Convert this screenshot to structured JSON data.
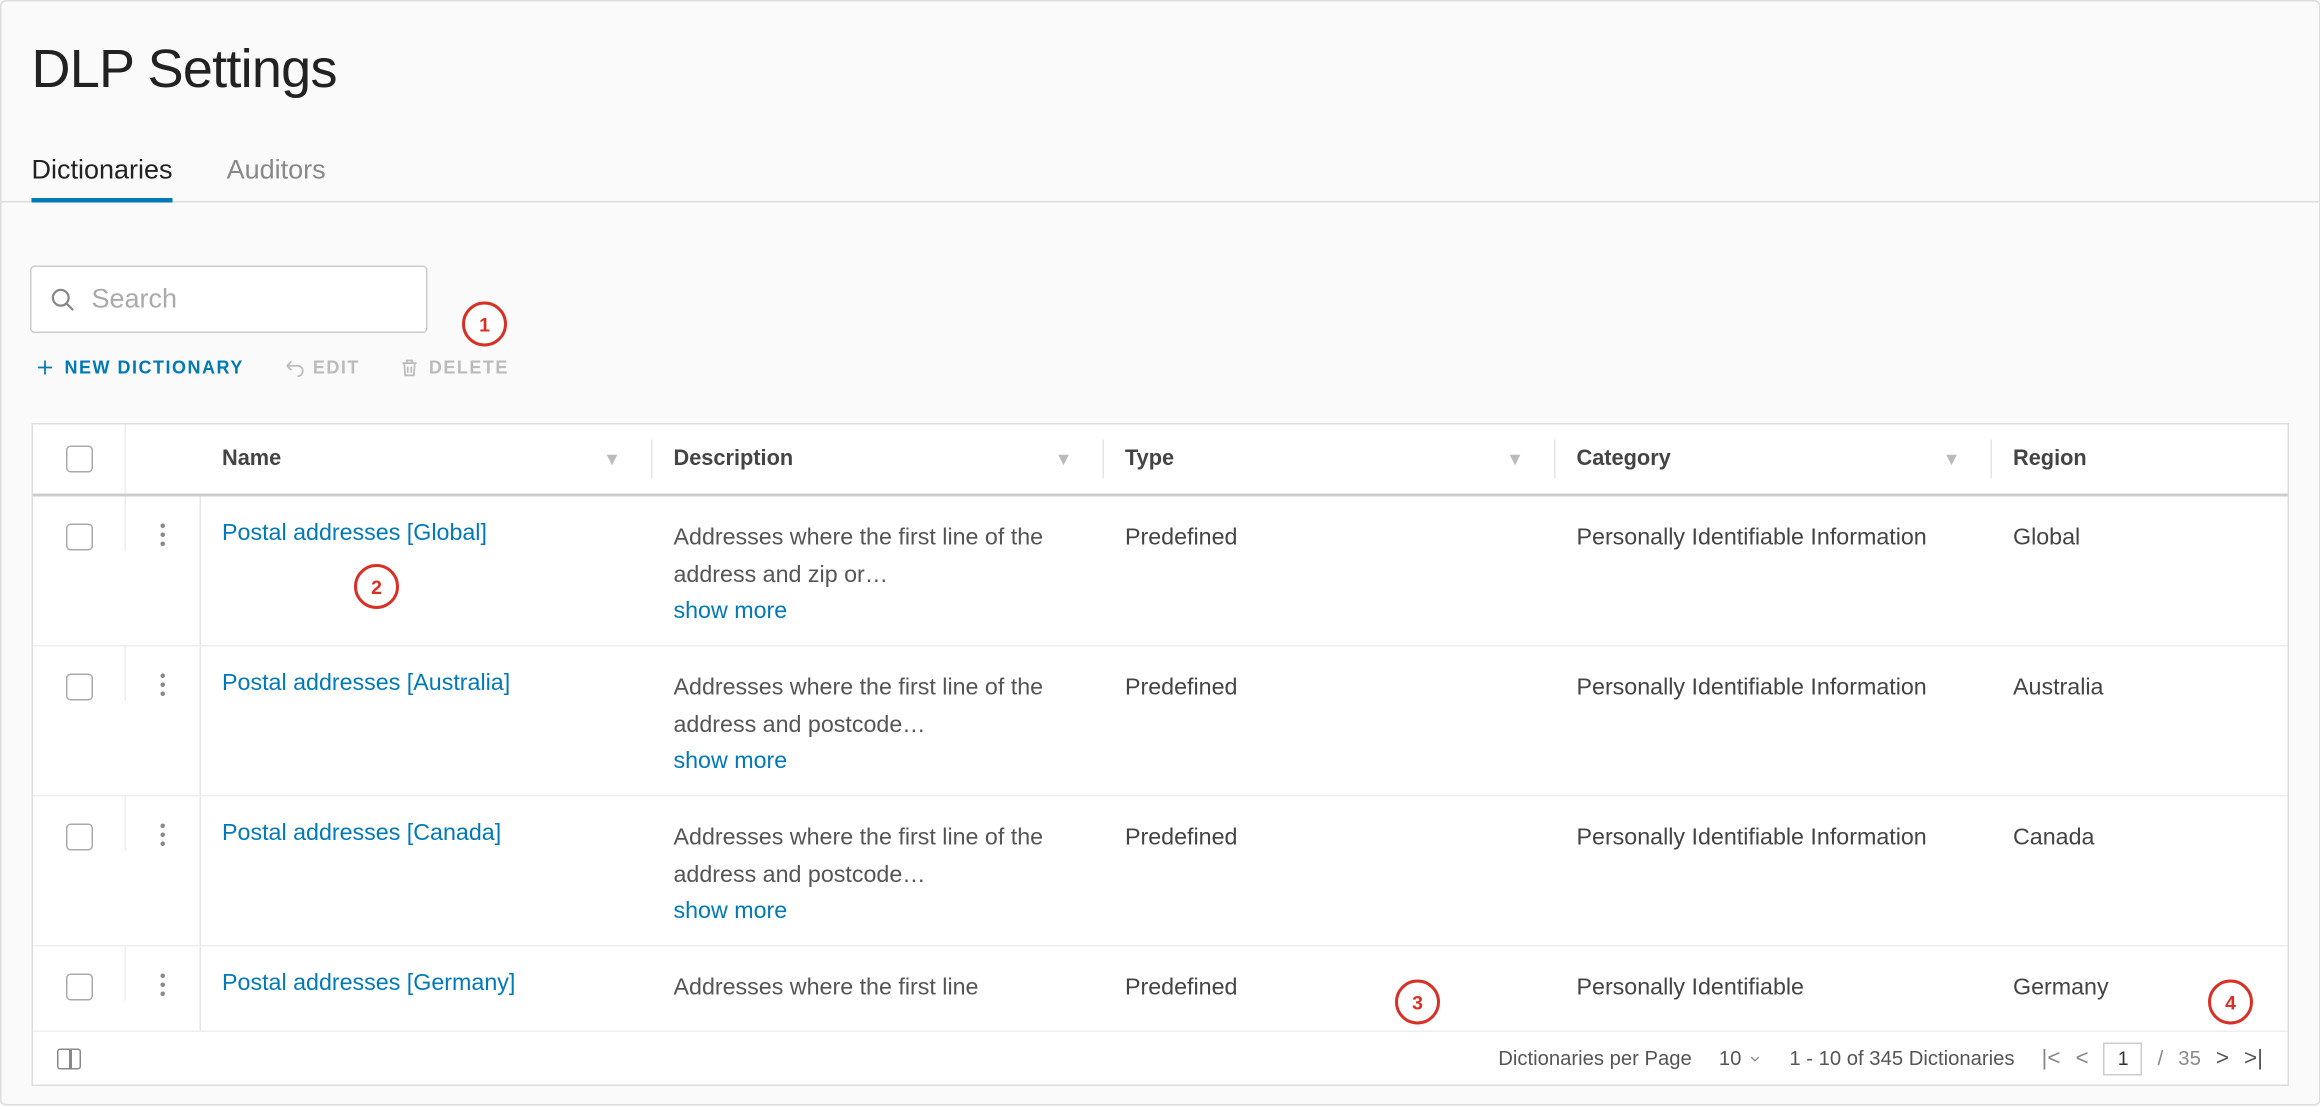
{
  "page_title": "DLP Settings",
  "tabs": {
    "dictionaries": "Dictionaries",
    "auditors": "Auditors"
  },
  "search": {
    "placeholder": "Search"
  },
  "actions": {
    "new": "NEW DICTIONARY",
    "edit": "EDIT",
    "delete": "DELETE"
  },
  "headers": {
    "name": "Name",
    "description": "Description",
    "type": "Type",
    "category": "Category",
    "region": "Region"
  },
  "show_more_label": "show more",
  "rows": [
    {
      "name": "Postal addresses [Global]",
      "description": "Addresses where the first line of the address and zip or…",
      "type": "Predefined",
      "category": "Personally Identifiable Information",
      "region": "Global"
    },
    {
      "name": "Postal addresses [Australia]",
      "description": "Addresses where the first line of the address and postcode…",
      "type": "Predefined",
      "category": "Personally Identifiable Information",
      "region": "Australia"
    },
    {
      "name": "Postal addresses [Canada]",
      "description": "Addresses where the first line of the address and postcode…",
      "type": "Predefined",
      "category": "Personally Identifiable Information",
      "region": "Canada"
    },
    {
      "name": "Postal addresses [Germany]",
      "description": "Addresses where the first line",
      "type": "Predefined",
      "category": "Personally Identifiable",
      "region": "Germany"
    }
  ],
  "footer": {
    "per_page_label": "Dictionaries per Page",
    "per_page_value": "10",
    "range_label": "1 - 10 of 345 Dictionaries",
    "page_current": "1",
    "page_sep": "/",
    "page_total": "35"
  },
  "annotations": {
    "a1": "1",
    "a2": "2",
    "a3": "3",
    "a4": "4"
  }
}
